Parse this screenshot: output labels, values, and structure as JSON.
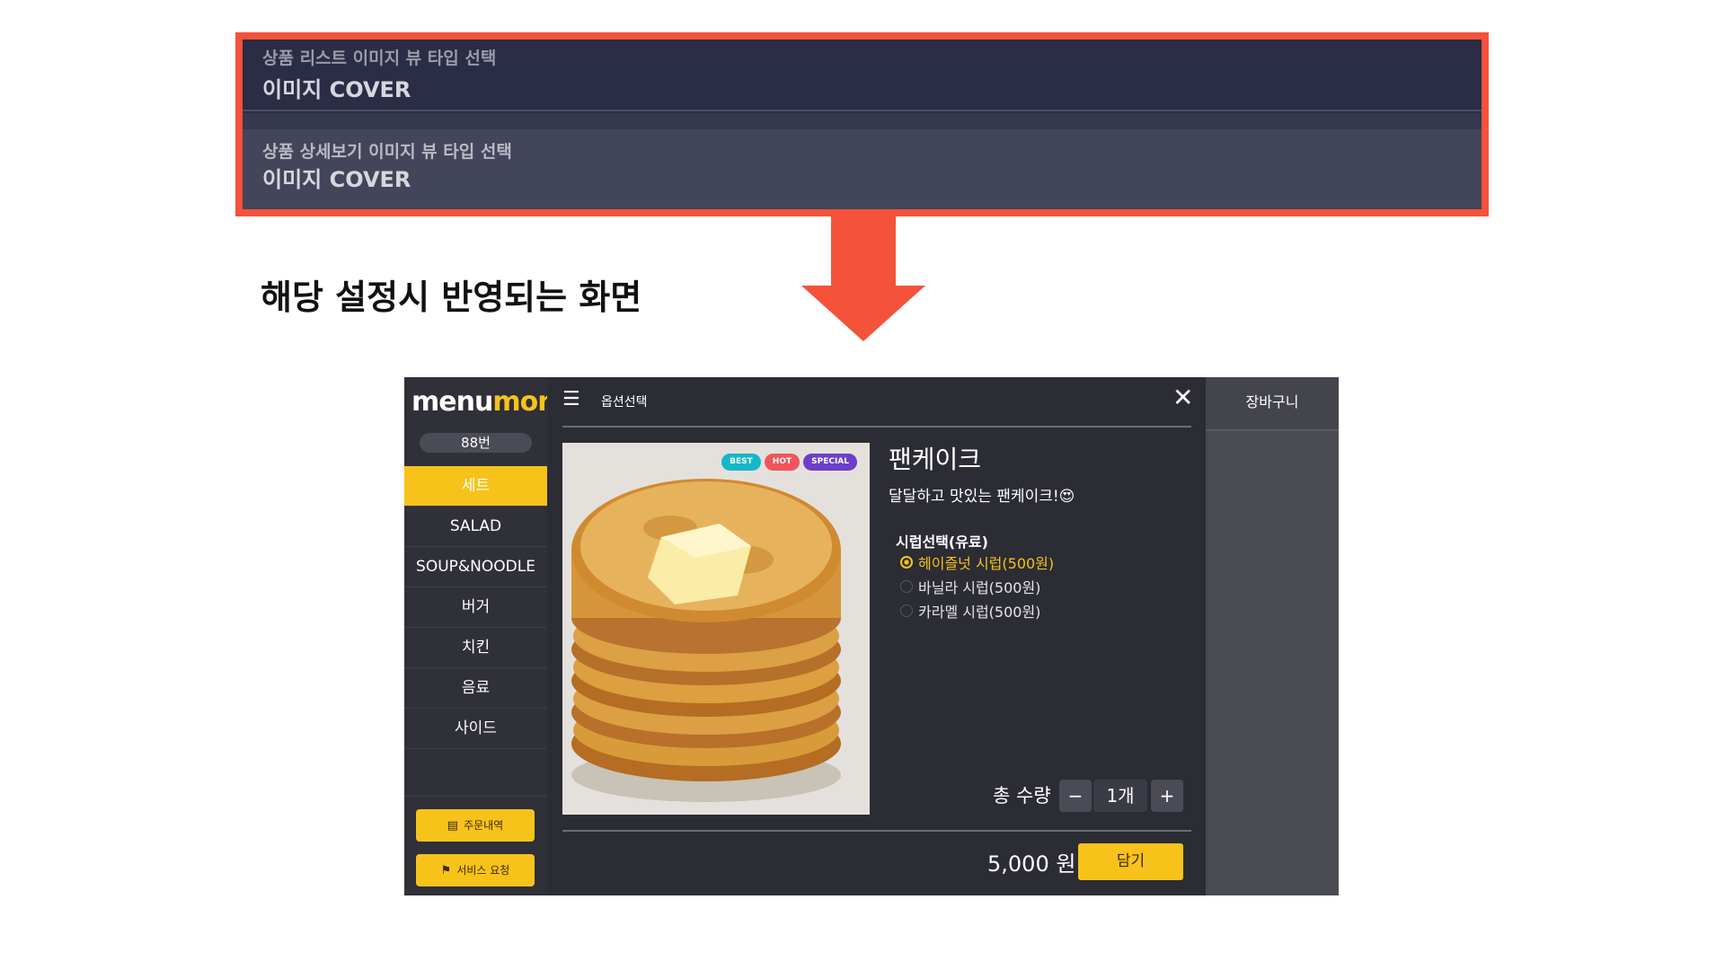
{
  "settings": {
    "list_view": {
      "label": "상품 리스트 이미지 뷰 타입 선택",
      "value": "이미지 COVER"
    },
    "detail_view": {
      "label": "상품 상세보기 이미지 뷰 타입 선택",
      "value": "이미지 COVER"
    }
  },
  "caption": "해당 설정시 반영되는 화면",
  "colors": {
    "highlight": "#f4523a",
    "accent": "#f7c21a"
  },
  "app": {
    "logo_main": "menu",
    "logo_accent": "mon",
    "table_no": "88번",
    "categories": [
      {
        "label": "세트",
        "active": true
      },
      {
        "label": "SALAD"
      },
      {
        "label": "SOUP&NOODLE"
      },
      {
        "label": "버거"
      },
      {
        "label": "치킨"
      },
      {
        "label": "음료"
      },
      {
        "label": "사이드"
      }
    ],
    "order_history_button": "주문내역",
    "service_request_button": "서비스 요청",
    "cart_title": "장바구니",
    "modal": {
      "title": "옵션선택",
      "product_name": "팬케이크",
      "description": "달달하고 맛있는 팬케이크!😍",
      "tags": [
        {
          "label": "BEST",
          "color": "#17b6c9"
        },
        {
          "label": "HOT",
          "color": "#f0555a"
        },
        {
          "label": "SPECIAL",
          "color": "#6d3ec9"
        }
      ],
      "option_group": "시럽선택(유료)",
      "options": [
        {
          "label": "헤이즐넛 시럽(500원)",
          "selected": true
        },
        {
          "label": "바닐라 시럽(500원)"
        },
        {
          "label": "카라멜 시럽(500원)"
        }
      ],
      "quantity_label": "총 수량",
      "quantity_minus": "−",
      "quantity_value": "1개",
      "quantity_plus": "+",
      "price": "5,000 원",
      "add_button": "담기"
    }
  }
}
